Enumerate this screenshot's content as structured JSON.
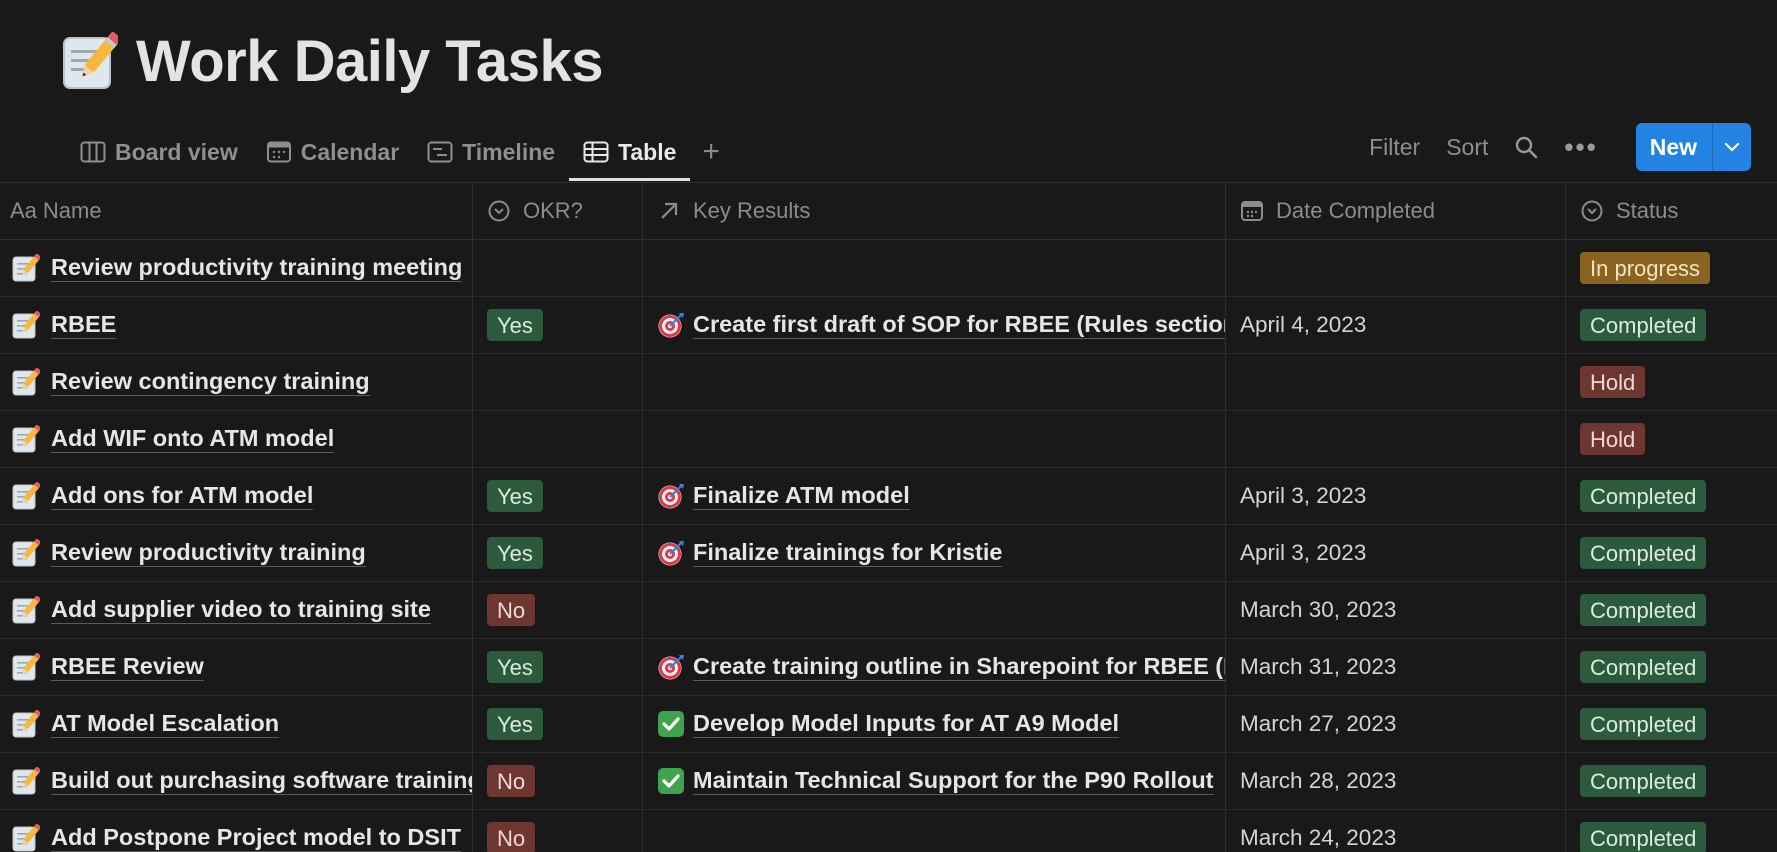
{
  "page": {
    "title": "Work Daily Tasks",
    "title_icon": "memo-pencil-icon"
  },
  "views": {
    "tabs": [
      {
        "label": "Board view",
        "icon": "board-icon",
        "active": false
      },
      {
        "label": "Calendar",
        "icon": "calendar-icon",
        "active": false
      },
      {
        "label": "Timeline",
        "icon": "timeline-icon",
        "active": false
      },
      {
        "label": "Table",
        "icon": "table-icon",
        "active": true
      }
    ],
    "add_symbol": "+"
  },
  "toolbar": {
    "filter_label": "Filter",
    "sort_label": "Sort",
    "more_label": "•••",
    "new_label": "New"
  },
  "columns": {
    "name_prefix": "Aa",
    "name": "Name",
    "okr": "OKR?",
    "key_results": "Key Results",
    "date": "Date Completed",
    "status": "Status"
  },
  "colors": {
    "background": "#191919",
    "accent": "#2383e2",
    "yes": "#2b5a3c",
    "no": "#6e3630",
    "completed": "#2b5a3c",
    "hold": "#6e3630",
    "in_progress": "#8a6420"
  },
  "rows": [
    {
      "name": "Review productivity training meeting",
      "okr": "",
      "kr": "",
      "kr_icon": "",
      "date": "",
      "status": "In progress"
    },
    {
      "name": "RBEE",
      "okr": "Yes",
      "kr": "Create first draft of SOP for RBEE (Rules section)",
      "kr_icon": "target-icon",
      "date": "April 4, 2023",
      "status": "Completed"
    },
    {
      "name": "Review contingency training",
      "okr": "",
      "kr": "",
      "kr_icon": "",
      "date": "",
      "status": "Hold"
    },
    {
      "name": "Add WIF onto ATM model",
      "okr": "",
      "kr": "",
      "kr_icon": "",
      "date": "",
      "status": "Hold"
    },
    {
      "name": "Add ons for ATM model",
      "okr": "Yes",
      "kr": "Finalize ATM model",
      "kr_icon": "target-icon",
      "date": "April 3, 2023",
      "status": "Completed"
    },
    {
      "name": "Review productivity training",
      "okr": "Yes",
      "kr": "Finalize trainings for Kristie",
      "kr_icon": "target-icon",
      "date": "April 3, 2023",
      "status": "Completed"
    },
    {
      "name": "Add supplier video to training site",
      "okr": "No",
      "kr": "",
      "kr_icon": "",
      "date": "March 30, 2023",
      "status": "Completed"
    },
    {
      "name": "RBEE Review",
      "okr": "Yes",
      "kr": "Create training outline in Sharepoint for RBEE (Ru",
      "kr_icon": "target-icon",
      "date": "March 31, 2023",
      "status": "Completed"
    },
    {
      "name": "AT Model Escalation",
      "okr": "Yes",
      "kr": "Develop Model Inputs for AT A9 Model",
      "kr_icon": "check-mark-icon",
      "date": "March 27, 2023",
      "status": "Completed"
    },
    {
      "name": "Build out purchasing software training",
      "okr": "No",
      "kr": "Maintain Technical Support for the P90 Rollout",
      "kr_icon": "check-mark-icon",
      "date": "March 28, 2023",
      "status": "Completed"
    },
    {
      "name": "Add Postpone Project model to DSIT",
      "okr": "No",
      "kr": "",
      "kr_icon": "",
      "date": "March 24, 2023",
      "status": "Completed"
    }
  ]
}
